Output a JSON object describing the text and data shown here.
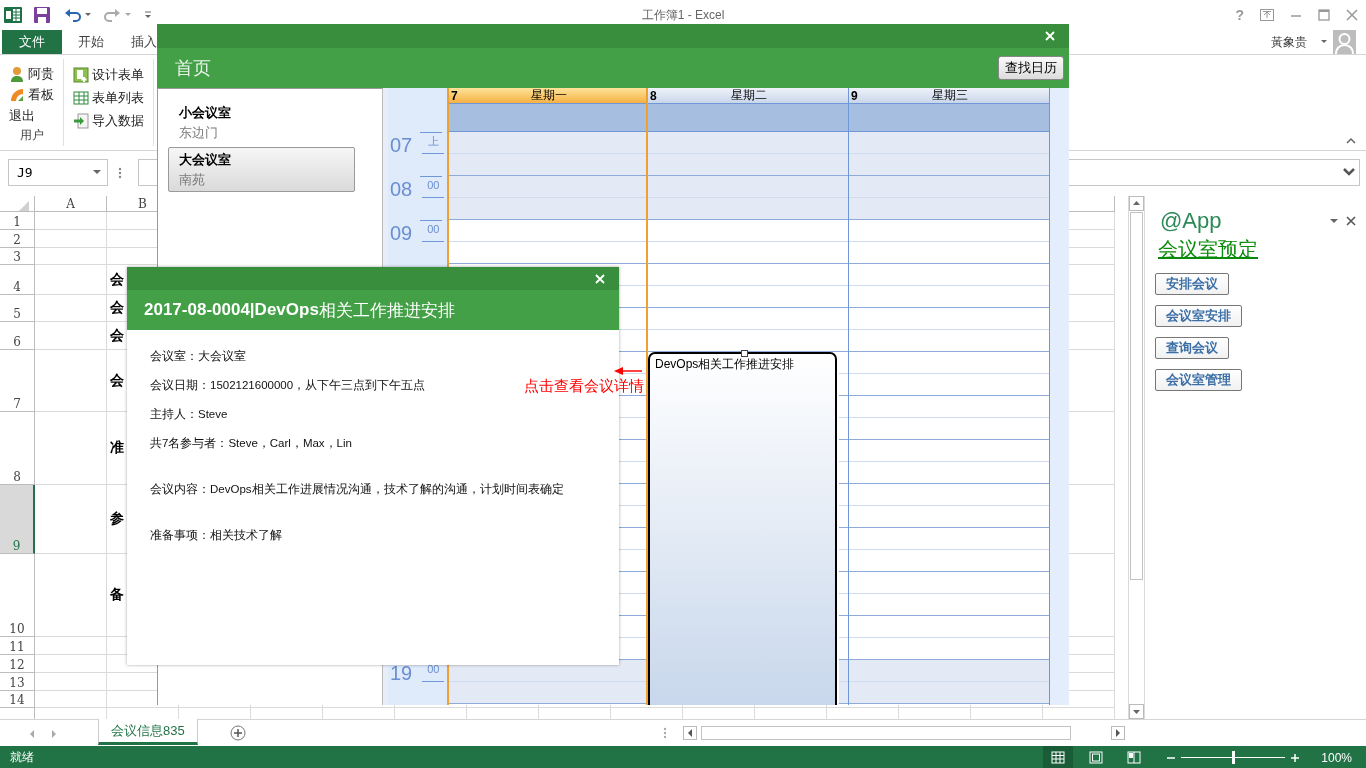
{
  "window": {
    "title": "工作簿1 - Excel",
    "help": "?"
  },
  "ribbon_tabs": [
    {
      "label": "文件",
      "selected": true
    },
    {
      "label": "开始",
      "selected": false
    },
    {
      "label": "插入",
      "selected": false
    }
  ],
  "account": {
    "name": "黃象贵"
  },
  "ribbon_groups": [
    {
      "label": "用户",
      "items": [
        "阿贵",
        "看板",
        "退出"
      ]
    },
    {
      "items": [
        "设计表单",
        "表单列表",
        "导入数据"
      ]
    }
  ],
  "name_box": "J9",
  "sheet": {
    "columns": [
      "A",
      "B"
    ],
    "rows": [
      {
        "number": "1",
        "selected": false
      },
      {
        "number": "2",
        "selected": false
      },
      {
        "number": "3",
        "selected": false
      },
      {
        "number": "4",
        "selected": false,
        "column_b": "会"
      },
      {
        "number": "5",
        "selected": false,
        "column_b": "会"
      },
      {
        "number": "6",
        "selected": false,
        "column_b": "会"
      },
      {
        "number": "7",
        "selected": false,
        "column_b": "会"
      },
      {
        "number": "8",
        "selected": false,
        "column_b": "准"
      },
      {
        "number": "9",
        "selected": true,
        "column_b": "参"
      },
      {
        "number": "10",
        "selected": false,
        "column_b": "备"
      },
      {
        "number": "11",
        "selected": false
      },
      {
        "number": "12",
        "selected": false
      },
      {
        "number": "13",
        "selected": false
      },
      {
        "number": "14",
        "selected": false
      }
    ]
  },
  "task_pane": {
    "title": "@App",
    "link": "会议室预定",
    "buttons": [
      "安排会议",
      "会议室安排",
      "查询会议",
      "会议室管理"
    ]
  },
  "sheet_tabs": [
    {
      "label": "会议信息835",
      "selected": true
    }
  ],
  "status_bar": {
    "text": "就绪",
    "zoom": "100%",
    "zoom_slider": {
      "level": 0.5
    },
    "views": [
      {
        "selected": true
      },
      {
        "selected": false
      },
      {
        "selected": false
      }
    ]
  },
  "calendar_dialog": {
    "title": "首页",
    "button": "查找日历",
    "rooms": [
      {
        "name": "小会议室",
        "location": "东边门",
        "selected": false
      },
      {
        "name": "大会议室",
        "location": "南苑",
        "selected": true
      }
    ],
    "days": [
      {
        "date": "7",
        "weekday": "星期一",
        "selected": true
      },
      {
        "date": "8",
        "weekday": "星期二",
        "selected": false,
        "events": [
          {
            "title": "DevOps相关工作推进安排"
          }
        ]
      },
      {
        "date": "9",
        "weekday": "星期三",
        "selected": false
      }
    ],
    "hours": [
      {
        "hour": "07",
        "suffix": "上",
        "off_hours": true
      },
      {
        "hour": "08",
        "suffix": "00",
        "off_hours": true
      },
      {
        "hour": "09",
        "suffix": "00",
        "off_hours": false
      },
      {
        "off_hours": false
      },
      {
        "off_hours": false
      },
      {
        "off_hours": false
      },
      {
        "off_hours": false
      },
      {
        "off_hours": false
      },
      {
        "off_hours": false
      },
      {
        "off_hours": false
      },
      {
        "off_hours": false
      },
      {
        "off_hours": false
      },
      {
        "hour": "19",
        "suffix": "00",
        "off_hours": true
      }
    ]
  },
  "detail_dialog": {
    "title": "**2017-08-0004|DevOps**相关工作推进安排",
    "lines": [
      {
        "kind": "field",
        "text": "会议室：大会议室"
      },
      {
        "kind": "field",
        "text": "会议日期：1502121600000，从下午三点到下午五点"
      },
      {
        "kind": "field",
        "text": "主持人：Steve"
      },
      {
        "kind": "field",
        "text": "共7名参与者：Steve，Carl，Max，Lin"
      },
      {
        "kind": "section",
        "text": "会议内容：DevOps相关工作进展情况沟通，技术了解的沟通，计划时间表确定"
      },
      {
        "kind": "section",
        "text": "准备事项：相关技术了解"
      }
    ]
  },
  "annotation": {
    "text": "点击查看会议详情"
  }
}
